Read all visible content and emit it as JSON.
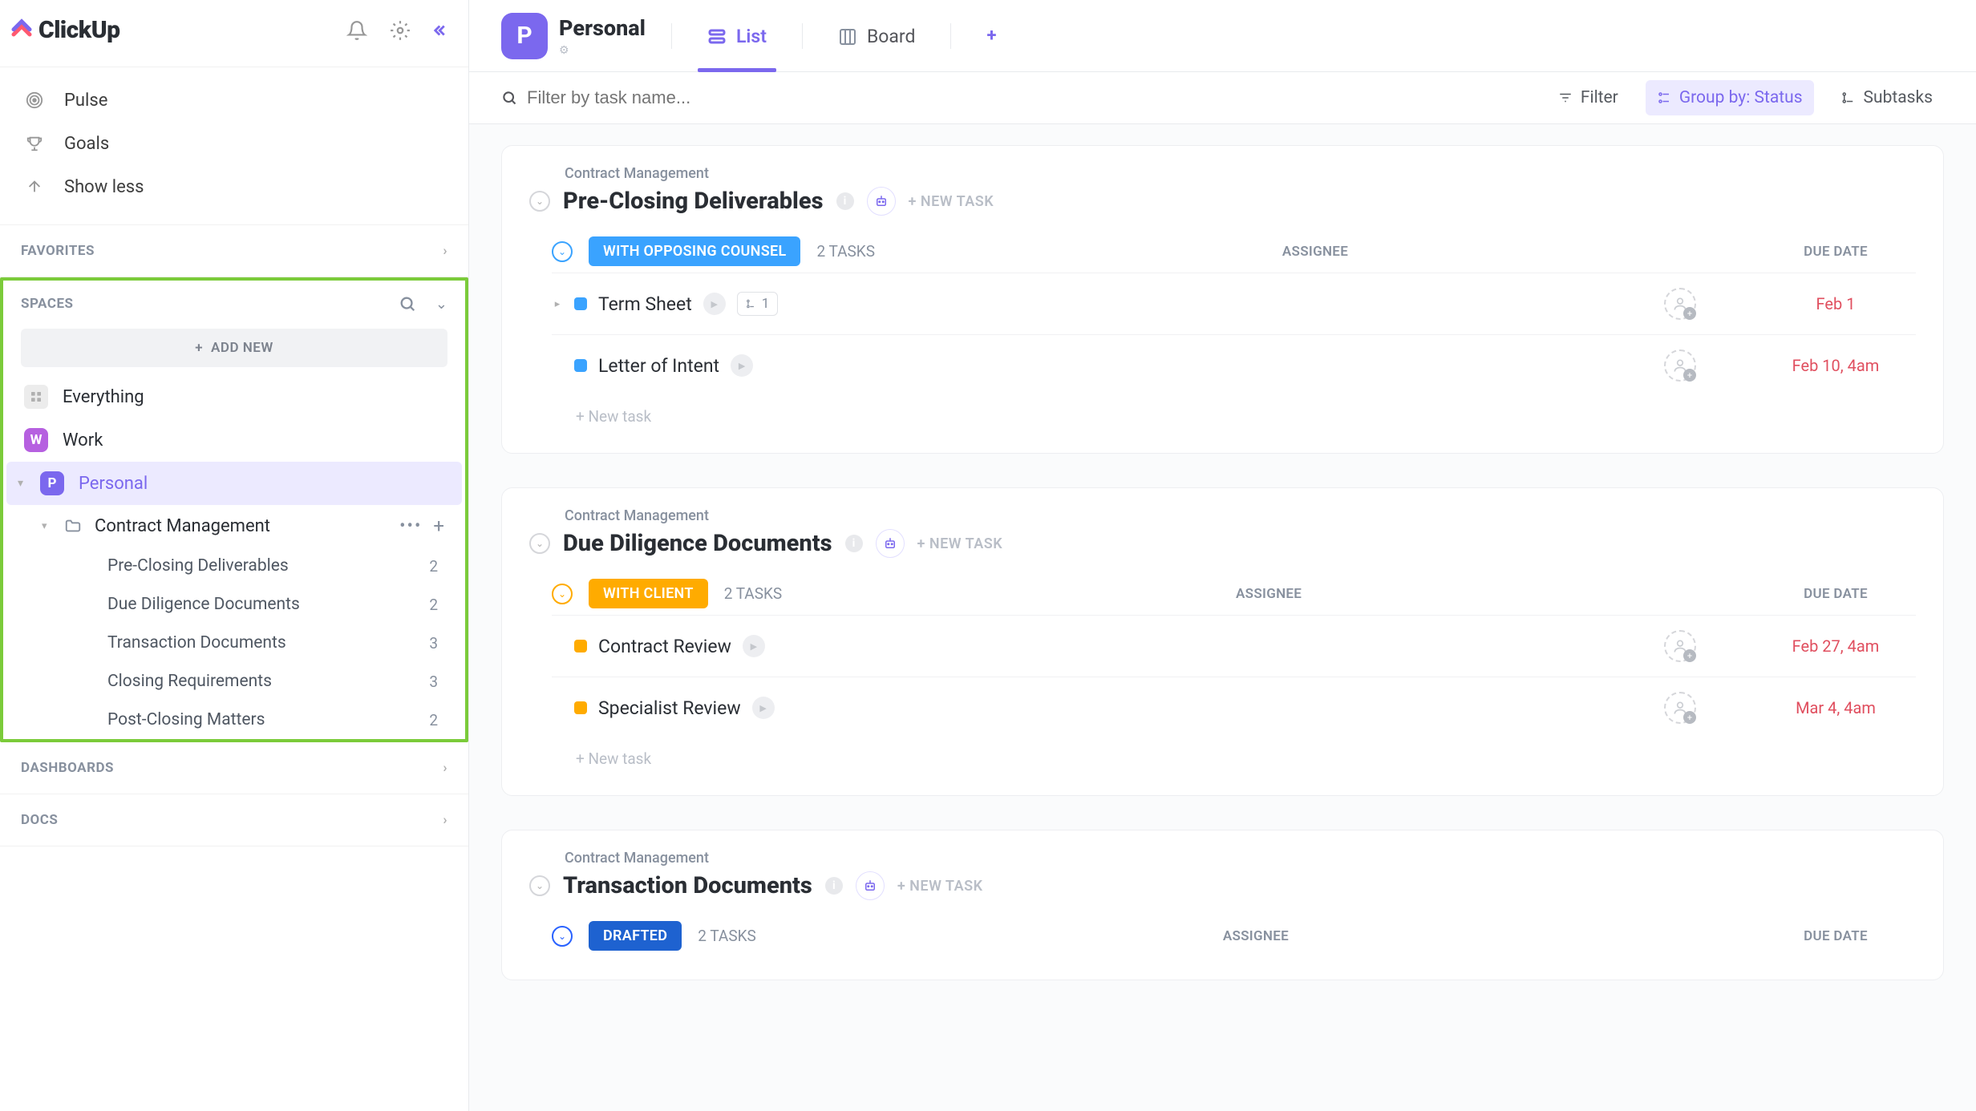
{
  "app": {
    "name": "ClickUp"
  },
  "sidebar_nav": {
    "pulse": "Pulse",
    "goals": "Goals",
    "showless": "Show less"
  },
  "sections": {
    "favorites": "FAVORITES",
    "spaces": "SPACES",
    "dashboards": "DASHBOARDS",
    "docs": "DOCS"
  },
  "add_new": "ADD NEW",
  "spaces": {
    "everything": "Everything",
    "work": "Work",
    "personal": "Personal"
  },
  "folder": {
    "name": "Contract Management",
    "lists": [
      {
        "name": "Pre-Closing Deliverables",
        "count": "2"
      },
      {
        "name": "Due Diligence Documents",
        "count": "2"
      },
      {
        "name": "Transaction Documents",
        "count": "3"
      },
      {
        "name": "Closing Requirements",
        "count": "3"
      },
      {
        "name": "Post-Closing Matters",
        "count": "2"
      }
    ]
  },
  "topbar": {
    "space_letter": "P",
    "space_name": "Personal",
    "views": {
      "list": "List",
      "board": "Board"
    }
  },
  "filterbar": {
    "search_placeholder": "Filter by task name...",
    "filter": "Filter",
    "groupby": "Group by: Status",
    "subtasks": "Subtasks"
  },
  "labels": {
    "new_task": "+ NEW TASK",
    "assignee": "ASSIGNEE",
    "due_date": "DUE DATE",
    "add_task": "+ New task"
  },
  "blocks": [
    {
      "folder": "Contract Management",
      "title": "Pre-Closing Deliverables",
      "groups": [
        {
          "status": "WITH OPPOSING COUNSEL",
          "color": "blue",
          "count": "2 TASKS",
          "tasks": [
            {
              "name": "Term Sheet",
              "due": "Feb 1",
              "sub": "1",
              "caret": true
            },
            {
              "name": "Letter of Intent",
              "due": "Feb 10, 4am"
            }
          ]
        }
      ]
    },
    {
      "folder": "Contract Management",
      "title": "Due Diligence Documents",
      "groups": [
        {
          "status": "WITH CLIENT",
          "color": "orange",
          "count": "2 TASKS",
          "tasks": [
            {
              "name": "Contract Review",
              "due": "Feb 27, 4am"
            },
            {
              "name": "Specialist Review",
              "due": "Mar 4, 4am"
            }
          ]
        }
      ]
    },
    {
      "folder": "Contract Management",
      "title": "Transaction Documents",
      "groups": [
        {
          "status": "DRAFTED",
          "color": "dblue",
          "count": "2 TASKS",
          "tasks": []
        }
      ]
    }
  ]
}
